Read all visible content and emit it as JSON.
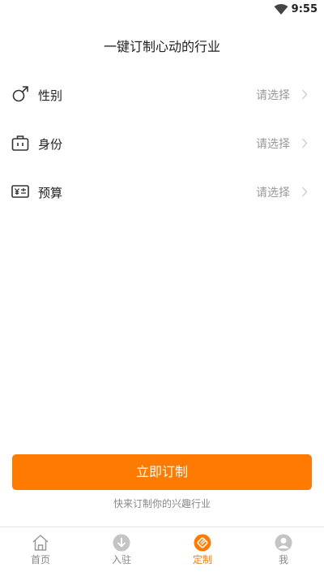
{
  "status_bar": {
    "time": "9:55",
    "wifi_icon": "wifi-icon"
  },
  "header": {
    "title": "一键订制心动的行业"
  },
  "form": {
    "rows": [
      {
        "label": "性别",
        "value": "请选择",
        "icon": "gender-male-icon"
      },
      {
        "label": "身份",
        "value": "请选择",
        "icon": "briefcase-icon"
      },
      {
        "label": "预算",
        "value": "请选择",
        "icon": "money-icon"
      }
    ]
  },
  "actions": {
    "submit_label": "立即订制",
    "hint": "快来订制你的兴趣行业"
  },
  "tab_bar": {
    "items": [
      {
        "label": "首页",
        "icon": "home-icon",
        "active": false
      },
      {
        "label": "入驻",
        "icon": "download-circle-icon",
        "active": false
      },
      {
        "label": "定制",
        "icon": "custom-tag-icon",
        "active": true
      },
      {
        "label": "我",
        "icon": "user-icon",
        "active": false
      }
    ]
  },
  "colors": {
    "accent": "#ff7a00",
    "muted": "#999999",
    "inactive_tab": "#888888"
  }
}
